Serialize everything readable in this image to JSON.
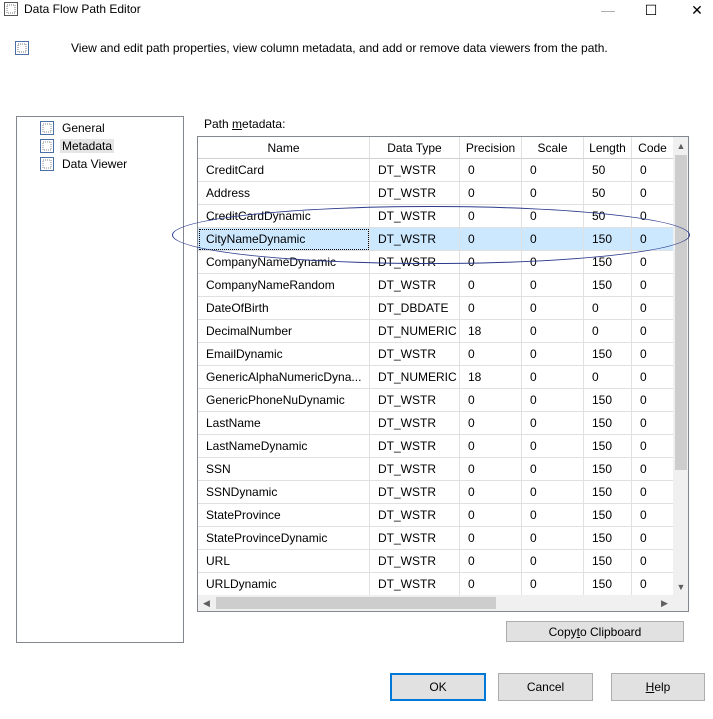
{
  "window": {
    "title": "Data Flow Path Editor",
    "minimize_glyph": "—",
    "maximize_glyph": "☐",
    "close_glyph": "✕"
  },
  "header": {
    "description": "View and edit path properties, view column metadata, and add or remove data viewers from the path."
  },
  "sidebar": {
    "items": [
      {
        "label": "General",
        "icon": "property-page-icon",
        "selected": false
      },
      {
        "label": "Metadata",
        "icon": "property-page-icon",
        "selected": true
      },
      {
        "label": "Data Viewer",
        "icon": "property-page-icon",
        "selected": false
      }
    ]
  },
  "metadata": {
    "label_prefix": "Path ",
    "label_accel": "m",
    "label_suffix": "etadata:",
    "columns": [
      "Name",
      "Data Type",
      "Precision",
      "Scale",
      "Length",
      "Code"
    ],
    "rows": [
      [
        "CreditCard",
        "DT_WSTR",
        "0",
        "0",
        "50",
        "0"
      ],
      [
        "Address",
        "DT_WSTR",
        "0",
        "0",
        "50",
        "0"
      ],
      [
        "CreditCardDynamic",
        "DT_WSTR",
        "0",
        "0",
        "50",
        "0"
      ],
      [
        "CityNameDynamic",
        "DT_WSTR",
        "0",
        "0",
        "150",
        "0"
      ],
      [
        "CompanyNameDynamic",
        "DT_WSTR",
        "0",
        "0",
        "150",
        "0"
      ],
      [
        "CompanyNameRandom",
        "DT_WSTR",
        "0",
        "0",
        "150",
        "0"
      ],
      [
        "DateOfBirth",
        "DT_DBDATE",
        "0",
        "0",
        "0",
        "0"
      ],
      [
        "DecimalNumber",
        "DT_NUMERIC",
        "18",
        "0",
        "0",
        "0"
      ],
      [
        "EmailDynamic",
        "DT_WSTR",
        "0",
        "0",
        "150",
        "0"
      ],
      [
        "GenericAlphaNumericDyna...",
        "DT_NUMERIC",
        "18",
        "0",
        "0",
        "0"
      ],
      [
        "GenericPhoneNuDynamic",
        "DT_WSTR",
        "0",
        "0",
        "150",
        "0"
      ],
      [
        "LastName",
        "DT_WSTR",
        "0",
        "0",
        "150",
        "0"
      ],
      [
        "LastNameDynamic",
        "DT_WSTR",
        "0",
        "0",
        "150",
        "0"
      ],
      [
        "SSN",
        "DT_WSTR",
        "0",
        "0",
        "150",
        "0"
      ],
      [
        "SSNDynamic",
        "DT_WSTR",
        "0",
        "0",
        "150",
        "0"
      ],
      [
        "StateProvince",
        "DT_WSTR",
        "0",
        "0",
        "150",
        "0"
      ],
      [
        "StateProvinceDynamic",
        "DT_WSTR",
        "0",
        "0",
        "150",
        "0"
      ],
      [
        "URL",
        "DT_WSTR",
        "0",
        "0",
        "150",
        "0"
      ],
      [
        "URLDynamic",
        "DT_WSTR",
        "0",
        "0",
        "150",
        "0"
      ]
    ],
    "selected_row": 3,
    "copy_label_pre": "Copy ",
    "copy_label_accel": "t",
    "copy_label_post": "o Clipboard"
  },
  "buttons": {
    "ok": "OK",
    "cancel": "Cancel",
    "help_accel": "H",
    "help_rest": "elp"
  },
  "colors": {
    "selection": "#cce8ff",
    "annotation": "#2b3a8c",
    "default_button_border": "#0078d7"
  }
}
